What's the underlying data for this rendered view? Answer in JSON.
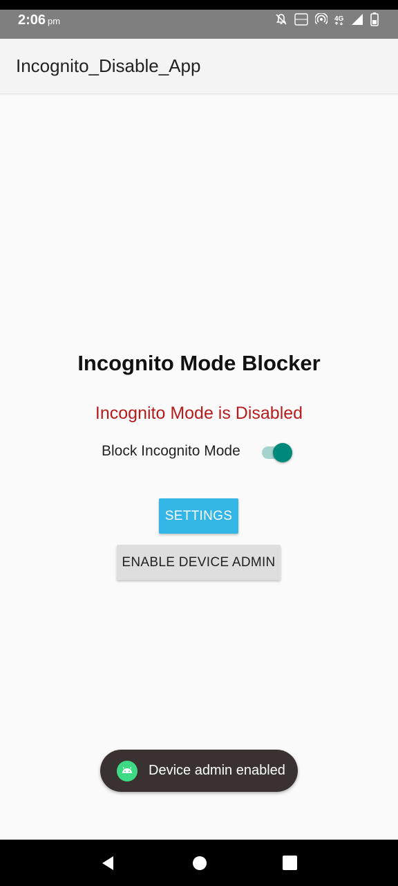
{
  "status_bar": {
    "time": "2:06",
    "ampm": "pm",
    "icons": [
      "bell-off-icon",
      "volte-icon",
      "hotspot-icon",
      "4g-icon",
      "signal-icon",
      "battery-icon"
    ],
    "volte_label": "VO LTE",
    "network_label": "4G"
  },
  "app_bar": {
    "title": "Incognito_Disable_App"
  },
  "main": {
    "title": "Incognito Mode Blocker",
    "status": "Incognito Mode is Disabled",
    "status_color": "#b71c1c",
    "toggle": {
      "label": "Block Incognito Mode",
      "checked": true,
      "color": "#00897b"
    },
    "settings_button": "SETTINGS",
    "settings_button_color": "#33b5e5",
    "admin_button": "ENABLE DEVICE ADMIN"
  },
  "toast": {
    "icon": "android-icon",
    "message": "Device admin enabled"
  },
  "nav_bar": {
    "buttons": [
      "back-icon",
      "home-icon",
      "recents-icon"
    ]
  }
}
